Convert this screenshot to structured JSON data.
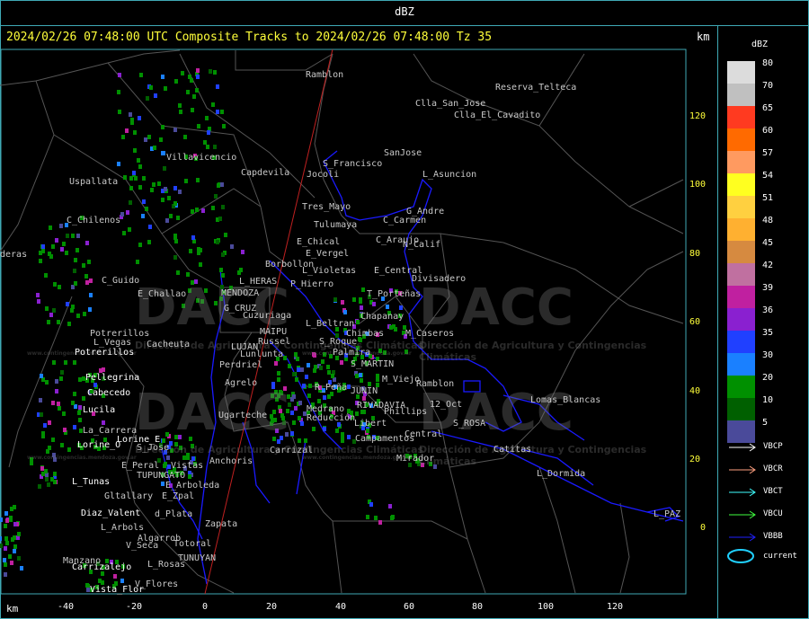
{
  "window": {
    "title": "dBZ"
  },
  "header": {
    "text": "2024/02/26 07:48:00 UTC Composite Tracks to 2024/02/26 07:48:00 Tz 35",
    "km_label": "km"
  },
  "axes": {
    "x_label": "km",
    "x_ticks": [
      "-40",
      "-20",
      "0",
      "20",
      "40",
      "60",
      "80",
      "100",
      "120"
    ],
    "y_ticks": [
      "120",
      "100",
      "80",
      "60",
      "40",
      "20",
      "0"
    ]
  },
  "watermark": {
    "logo_text": "DACC",
    "org_text": "Dirección de Agricultura y Contingencias Climáticas",
    "url_text": "www.contingencias.mendoza.gov.ar"
  },
  "cities": [
    {
      "name": "Ramblon",
      "white": false
    },
    {
      "name": "Reserva_Telteca",
      "white": false
    },
    {
      "name": "Clla_San_Jose",
      "white": false
    },
    {
      "name": "Clla_El_Cavadito",
      "white": false
    },
    {
      "name": "SanJose",
      "white": false
    },
    {
      "name": "S_Francisco",
      "white": false
    },
    {
      "name": "Uspallata",
      "white": false
    },
    {
      "name": "Villavicencio",
      "white": false
    },
    {
      "name": "Capdevila",
      "white": false
    },
    {
      "name": "Jocoli",
      "white": false
    },
    {
      "name": "L_Asuncion",
      "white": false
    },
    {
      "name": "C_Chilenos",
      "white": false
    },
    {
      "name": "Tres_Mayo",
      "white": false
    },
    {
      "name": "G_Andre",
      "white": false
    },
    {
      "name": "C_Carmen",
      "white": false
    },
    {
      "name": "Tulumaya",
      "white": false
    },
    {
      "name": "E_Chical",
      "white": false
    },
    {
      "name": "C_Araujo",
      "white": false
    },
    {
      "name": "N_Calif",
      "white": false
    },
    {
      "name": "E_Vergel",
      "white": false
    },
    {
      "name": "Borbollon",
      "white": false
    },
    {
      "name": "L_Violetas",
      "white": false
    },
    {
      "name": "E_Central",
      "white": false
    },
    {
      "name": "deras",
      "white": false
    },
    {
      "name": "C_Guido",
      "white": false
    },
    {
      "name": "L_HERAS",
      "white": false
    },
    {
      "name": "P_Hierro",
      "white": false
    },
    {
      "name": "Divisadero",
      "white": false
    },
    {
      "name": "E_Challao",
      "white": false
    },
    {
      "name": "MENDOZA",
      "white": false
    },
    {
      "name": "T_Porteñas",
      "white": false
    },
    {
      "name": "G_CRUZ",
      "white": false
    },
    {
      "name": "Cuzuriaga",
      "white": false
    },
    {
      "name": "Chapanay",
      "white": false
    },
    {
      "name": "L_Beltran",
      "white": false
    },
    {
      "name": "MAIPU",
      "white": false
    },
    {
      "name": "Chimbas",
      "white": false
    },
    {
      "name": "M_Caseros",
      "white": false
    },
    {
      "name": "Potrerillos",
      "white": false
    },
    {
      "name": "Russel",
      "white": false
    },
    {
      "name": "S_Roque",
      "white": false
    },
    {
      "name": "L_Vegas",
      "white": false
    },
    {
      "name": "Cacheuta",
      "white": false
    },
    {
      "name": "LUJAN",
      "white": false
    },
    {
      "name": "Palmira",
      "white": false
    },
    {
      "name": "Potrerillos",
      "white": true
    },
    {
      "name": "Lunlunta",
      "white": false
    },
    {
      "name": "Perdriel",
      "white": false
    },
    {
      "name": "S_MARTIN",
      "white": false
    },
    {
      "name": "Pellegrina",
      "white": true
    },
    {
      "name": "M_Viejo",
      "white": false
    },
    {
      "name": "Ramblon",
      "white": false
    },
    {
      "name": "Agrelo",
      "white": false
    },
    {
      "name": "R_Peña",
      "white": false
    },
    {
      "name": "JUNIN",
      "white": false
    },
    {
      "name": "Cabecedo",
      "white": true
    },
    {
      "name": "Lomas_Blancas",
      "white": false
    },
    {
      "name": "Medrano",
      "white": false
    },
    {
      "name": "RIVADAVIA",
      "white": false
    },
    {
      "name": "12_Oct",
      "white": false
    },
    {
      "name": "Lucila",
      "white": true
    },
    {
      "name": "Ugarteche",
      "white": false
    },
    {
      "name": "Phillips",
      "white": false
    },
    {
      "name": "Reducción",
      "white": false
    },
    {
      "name": "S_ROSA",
      "white": false
    },
    {
      "name": "Libert",
      "white": false
    },
    {
      "name": "La_Carrera",
      "white": false
    },
    {
      "name": "Central",
      "white": false
    },
    {
      "name": "Campamentos",
      "white": false
    },
    {
      "name": "Lorine_E",
      "white": true
    },
    {
      "name": "Lorine_O",
      "white": true
    },
    {
      "name": "S_Jose",
      "white": false
    },
    {
      "name": "Carrizal",
      "white": false
    },
    {
      "name": "Catitas",
      "white": false
    },
    {
      "name": "Mirador",
      "white": false
    },
    {
      "name": "Anchoris",
      "white": false
    },
    {
      "name": "E_Peral",
      "white": false
    },
    {
      "name": "Vistas",
      "white": false
    },
    {
      "name": "L_Dormida",
      "white": false
    },
    {
      "name": "TUPUNGATO",
      "white": false
    },
    {
      "name": "L_Tunas",
      "white": true
    },
    {
      "name": "E_Arboleda",
      "white": false
    },
    {
      "name": "Gltallary",
      "white": false
    },
    {
      "name": "E_Zpal",
      "white": false
    },
    {
      "name": "Diaz_Valent",
      "white": true
    },
    {
      "name": "d_Plata",
      "white": false
    },
    {
      "name": "L_PAZ",
      "white": false
    },
    {
      "name": "Zapata",
      "white": false
    },
    {
      "name": "L_Arbols",
      "white": false
    },
    {
      "name": "Algarrob",
      "white": false
    },
    {
      "name": "V_Seca",
      "white": false
    },
    {
      "name": "Totoral",
      "white": false
    },
    {
      "name": "Manzano",
      "white": false
    },
    {
      "name": "TUNUYAN",
      "white": false
    },
    {
      "name": "Carrizalejo",
      "white": true
    },
    {
      "name": "L_Rosas",
      "white": false
    },
    {
      "name": "V_Flores",
      "white": false
    },
    {
      "name": "Vista_Flor",
      "white": true
    }
  ],
  "legend": {
    "title": "dBZ",
    "scale": [
      {
        "label": "80",
        "color": "#dcdcdc"
      },
      {
        "label": "70",
        "color": "#c0c0c0"
      },
      {
        "label": "65",
        "color": "#ff3a20"
      },
      {
        "label": "60",
        "color": "#ff6a00"
      },
      {
        "label": "57",
        "color": "#ff9a60"
      },
      {
        "label": "54",
        "color": "#ffff20"
      },
      {
        "label": "51",
        "color": "#ffd040"
      },
      {
        "label": "48",
        "color": "#ffb030"
      },
      {
        "label": "45",
        "color": "#d68a40"
      },
      {
        "label": "42",
        "color": "#c070a0"
      },
      {
        "label": "39",
        "color": "#c020a0"
      },
      {
        "label": "36",
        "color": "#8a20d0"
      },
      {
        "label": "35",
        "color": "#2040ff"
      },
      {
        "label": "30",
        "color": "#1a80ff"
      },
      {
        "label": "20",
        "color": "#009000"
      },
      {
        "label": "10",
        "color": "#006000"
      },
      {
        "label": "5",
        "color": "#4a4a9a"
      }
    ],
    "tracks": [
      {
        "label": "VBCP",
        "color": "#ffffff"
      },
      {
        "label": "VBCR",
        "color": "#ffa080"
      },
      {
        "label": "VBCT",
        "color": "#40ffff"
      },
      {
        "label": "VBCU",
        "color": "#40ff40"
      },
      {
        "label": "VBBB",
        "color": "#2020ff"
      }
    ],
    "current": {
      "label": "current",
      "color": "#20d0ff"
    }
  }
}
